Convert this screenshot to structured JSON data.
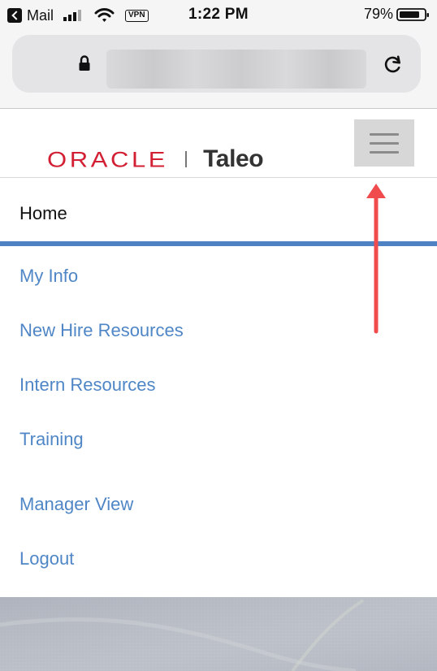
{
  "status_bar": {
    "back_app": "Mail",
    "vpn": "VPN",
    "time": "1:22 PM",
    "battery": "79%",
    "icons": {
      "back": "back-arrow-icon",
      "signal": "cellular-signal-icon",
      "wifi": "wifi-icon",
      "battery": "battery-icon"
    }
  },
  "browser": {
    "url_visible": "",
    "icons": {
      "lock": "lock-icon",
      "reload": "reload-icon"
    }
  },
  "site": {
    "logo": {
      "oracle": "ORACLE",
      "separator": "|",
      "taleo": "Taleo"
    },
    "menu_icon": "hamburger-menu-icon",
    "colors": {
      "oracle_red": "#d31f33",
      "link_blue": "#4f86c6",
      "active_bar_blue": "#4f82c2",
      "annotation_red": "#f04b4d"
    }
  },
  "nav": {
    "items": [
      {
        "label": "Home",
        "active": true
      },
      {
        "label": "My Info"
      },
      {
        "label": "New Hire Resources"
      },
      {
        "label": "Intern Resources"
      },
      {
        "label": "Training"
      },
      {
        "label": "Manager View"
      },
      {
        "label": "Logout"
      }
    ]
  },
  "annotation": {
    "arrow_color": "#f04b4d",
    "points_to": "hamburger-menu-button"
  }
}
